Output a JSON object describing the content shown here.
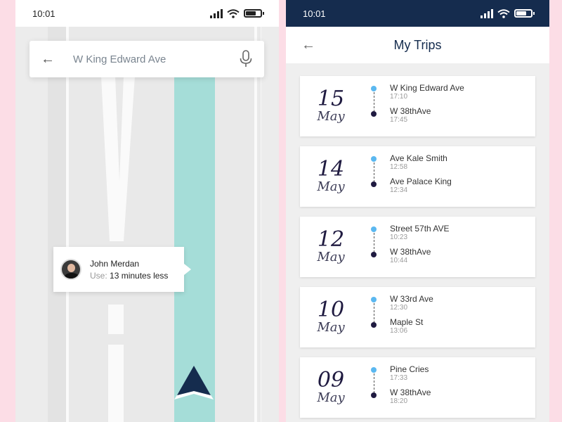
{
  "left": {
    "status": {
      "time": "10:01"
    },
    "search": {
      "value": "W King Edward Ave"
    },
    "driver": {
      "name": "John Merdan",
      "use_label": "Use:",
      "use_value": "13 minutes less"
    }
  },
  "right": {
    "status": {
      "time": "10:01"
    },
    "header": {
      "title": "My Trips"
    },
    "trips": [
      {
        "day": "15",
        "month": "May",
        "from": "W King Edward Ave",
        "from_time": "17:10",
        "to": "W 38thAve",
        "to_time": "17:45"
      },
      {
        "day": "14",
        "month": "May",
        "from": "Ave Kale Smith",
        "from_time": "12:58",
        "to": "Ave Palace King",
        "to_time": "12:34"
      },
      {
        "day": "12",
        "month": "May",
        "from": "Street 57th AVE",
        "from_time": "10:23",
        "to": "W 38thAve",
        "to_time": "10:44"
      },
      {
        "day": "10",
        "month": "May",
        "from": "W 33rd Ave",
        "from_time": "12:30",
        "to": "Maple St",
        "to_time": "13:06"
      },
      {
        "day": "09",
        "month": "May",
        "from": "Pine Cries",
        "from_time": "17:33",
        "to": "W 38thAve",
        "to_time": "18:20"
      }
    ]
  },
  "colors": {
    "navy": "#152c4e",
    "route": "#a5ddd8",
    "dot_start": "#5bb8f0",
    "dot_end": "#1f1a40",
    "background": "#fcdde6"
  }
}
